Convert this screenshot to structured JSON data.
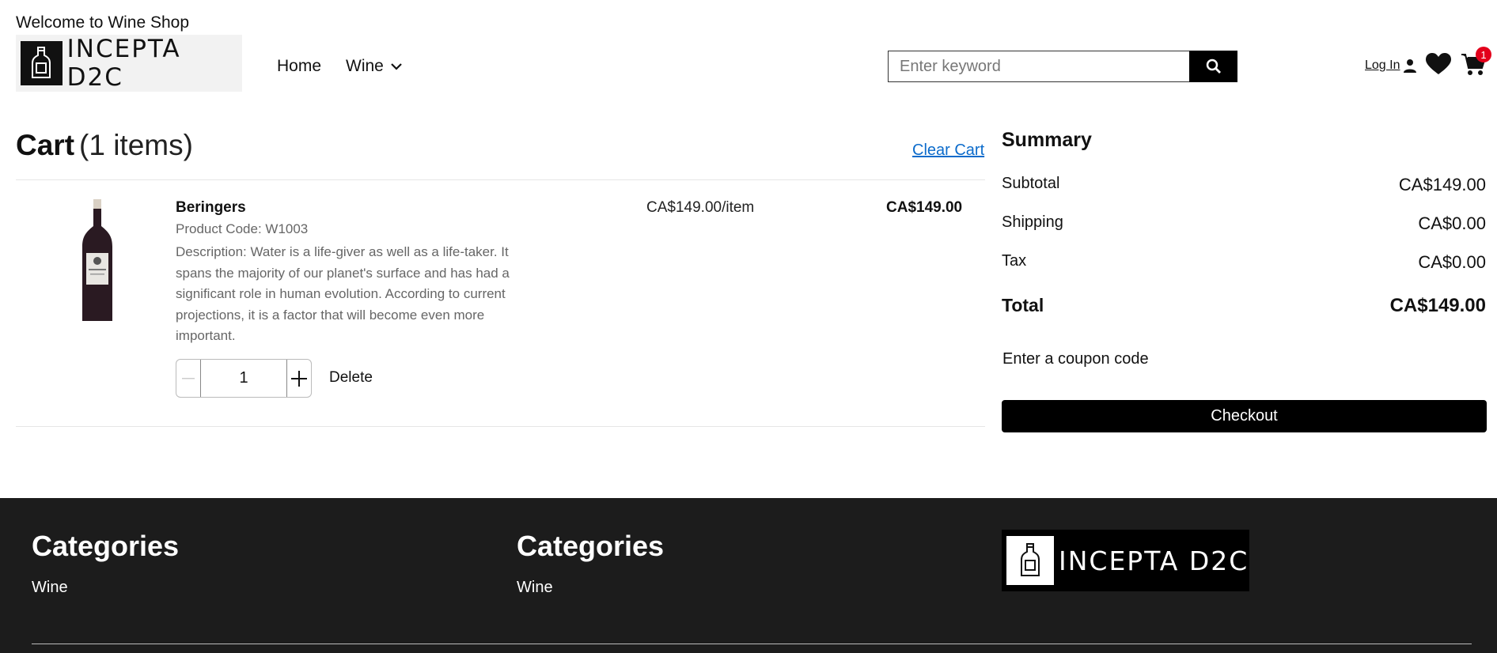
{
  "header": {
    "welcome": "Welcome to Wine Shop",
    "logo_text": "INCEPTA D2C",
    "nav": {
      "home": "Home",
      "wine": "Wine"
    },
    "search": {
      "placeholder": "Enter keyword",
      "value": ""
    },
    "login": "Log In",
    "cart_count": "1",
    "icons": [
      "user-icon",
      "heart-icon",
      "cart-icon",
      "search-icon",
      "chevron-down-icon"
    ]
  },
  "cart": {
    "title": "Cart",
    "count": "(1 items)",
    "clear": "Clear Cart",
    "items": [
      {
        "name": "Beringers",
        "code": "Product Code:  W1003",
        "description": "Description:  Water is a life-giver as well as a life-taker. It spans the majority of our planet's surface and has had a significant role in human evolution. According to current projections, it is a factor that will become even more important.",
        "unit_price": "CA$149.00/item",
        "total": "CA$149.00",
        "quantity": "1",
        "delete": "Delete"
      }
    ]
  },
  "summary": {
    "title": "Summary",
    "subtotal_label": "Subtotal",
    "subtotal": "CA$149.00",
    "shipping_label": "Shipping",
    "shipping": "CA$0.00",
    "tax_label": "Tax",
    "tax": "CA$0.00",
    "total_label": "Total",
    "total": "CA$149.00",
    "coupon": "Enter a coupon code",
    "checkout": "Checkout"
  },
  "footer": {
    "col1_title": "Categories",
    "col1_link": "Wine",
    "col2_title": "Categories",
    "col2_link": "Wine",
    "logo_text": "INCEPTA D2C"
  },
  "colors": {
    "accent_link": "#0b6bcb",
    "badge": "#e3001b",
    "footer_bg": "#1c1c1c"
  }
}
